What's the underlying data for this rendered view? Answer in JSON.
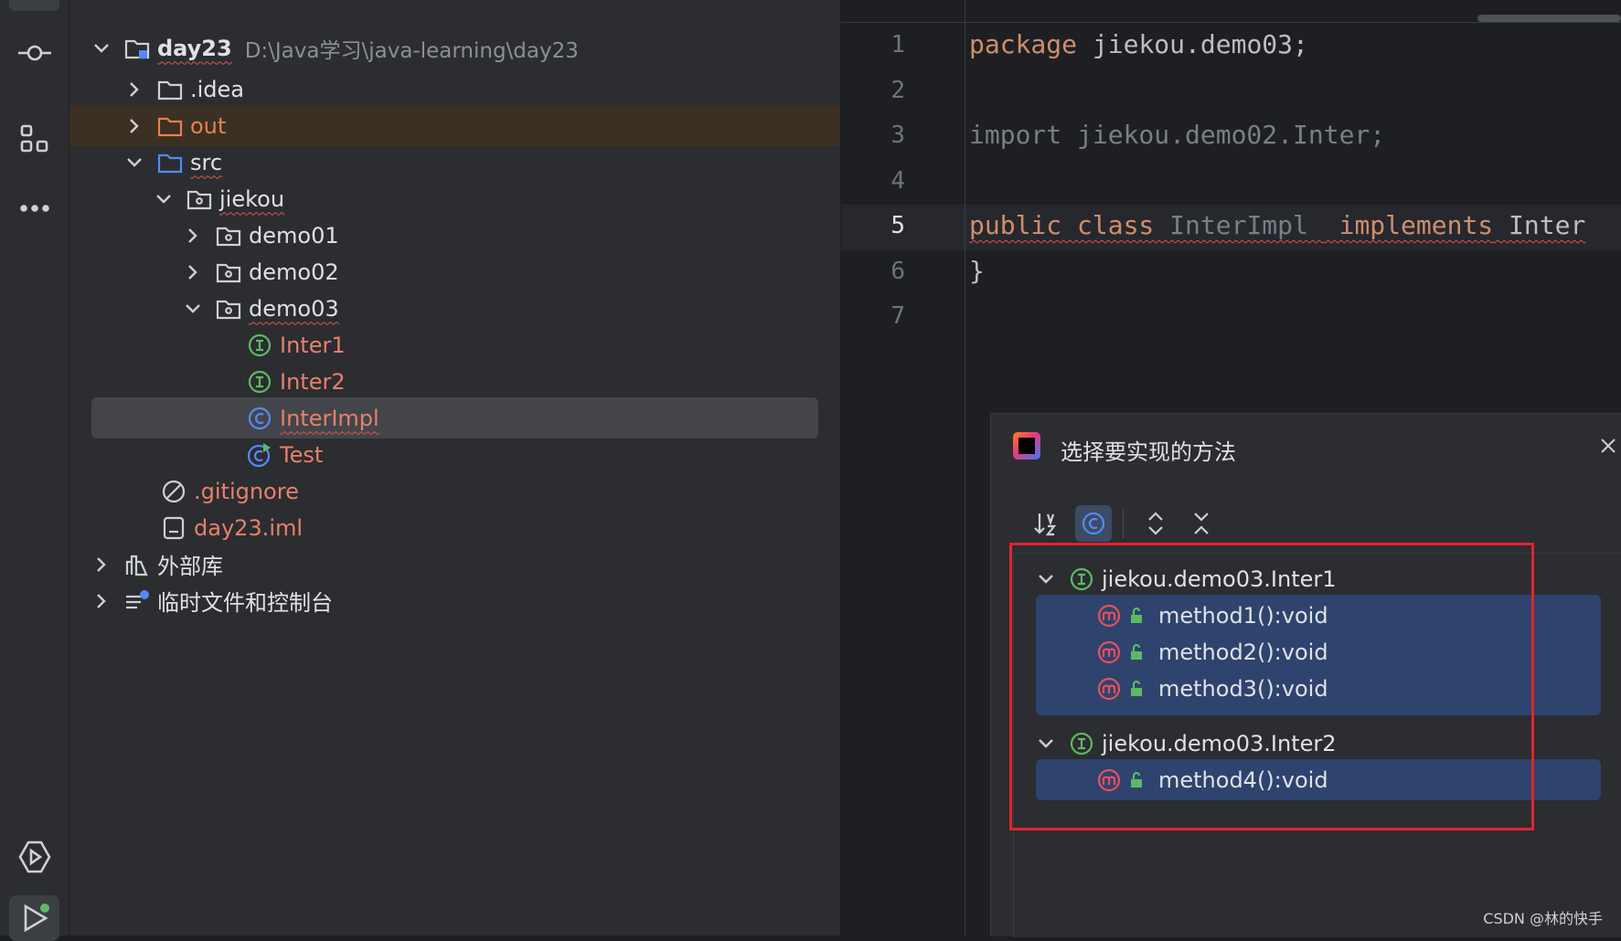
{
  "tree": {
    "root": {
      "name": "day23",
      "path": "D:\\Java学习\\java-learning\\day23"
    },
    "items": [
      {
        "label": ".idea"
      },
      {
        "label": "out"
      },
      {
        "label": "src"
      },
      {
        "label": "jiekou"
      },
      {
        "label": "demo01"
      },
      {
        "label": "demo02"
      },
      {
        "label": "demo03"
      },
      {
        "label": "Inter1"
      },
      {
        "label": "Inter2"
      },
      {
        "label": "InterImpl"
      },
      {
        "label": "Test"
      },
      {
        "label": ".gitignore"
      },
      {
        "label": "day23.iml"
      },
      {
        "label": "外部库"
      },
      {
        "label": "临时文件和控制台"
      }
    ]
  },
  "editor": {
    "line_numbers": [
      "1",
      "2",
      "3",
      "4",
      "5",
      "6",
      "7"
    ],
    "current_line": 5,
    "lines": {
      "l1_kw": "package",
      "l1_rest": " jiekou.demo03;",
      "l3": "import jiekou.demo02.Inter;",
      "l5_kw": "public class",
      "l5_name": " InterImpl ",
      "l5_impl": " implements",
      "l5_rest": " Inter",
      "l6": "}"
    }
  },
  "dialog": {
    "title": "选择要实现的方法",
    "groups": [
      {
        "name": "jiekou.demo03.Inter1",
        "methods": [
          "method1():void",
          "method2():void",
          "method3():void"
        ]
      },
      {
        "name": "jiekou.demo03.Inter2",
        "methods": [
          "method4():void"
        ]
      }
    ]
  },
  "watermark": "CSDN @林的快手",
  "colors": {
    "highlight": "#e0242d",
    "selection": "#2e436e",
    "interface_icon": "#5fb865",
    "class_icon": "#548af7",
    "method_icon": "#e8505b"
  }
}
